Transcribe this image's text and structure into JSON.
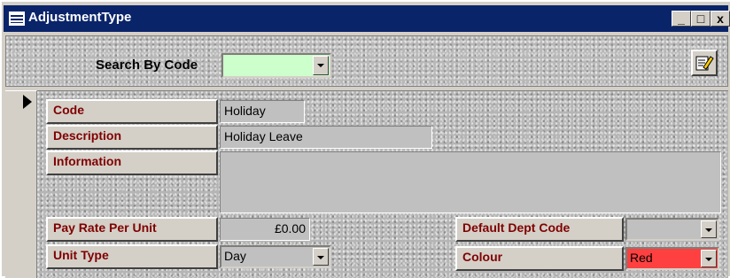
{
  "window": {
    "title": "AdjustmentType"
  },
  "title_buttons": {
    "minimize": "_",
    "maximize": "□",
    "close": "x"
  },
  "search": {
    "label": "Search By Code",
    "value": "",
    "bg_color": "#ccffcc"
  },
  "edit_button": {
    "icon": "edit-note-icon"
  },
  "record_selector": {
    "icon": "current-record-arrow-icon"
  },
  "fields": {
    "code": {
      "label": "Code",
      "value": "Holiday"
    },
    "description": {
      "label": "Description",
      "value": "Holiday Leave"
    },
    "information": {
      "label": "Information",
      "value": ""
    },
    "pay_rate": {
      "label": "Pay Rate Per Unit",
      "value": "£0.00"
    },
    "unit_type": {
      "label": "Unit Type",
      "value": "Day"
    },
    "default_dept_code": {
      "label": "Default Dept Code",
      "value": ""
    },
    "colour": {
      "label": "Colour",
      "value": "Red",
      "bg_color": "#ff4040"
    }
  },
  "colors": {
    "label_text": "#800000",
    "title_bar": "#0a246a"
  }
}
